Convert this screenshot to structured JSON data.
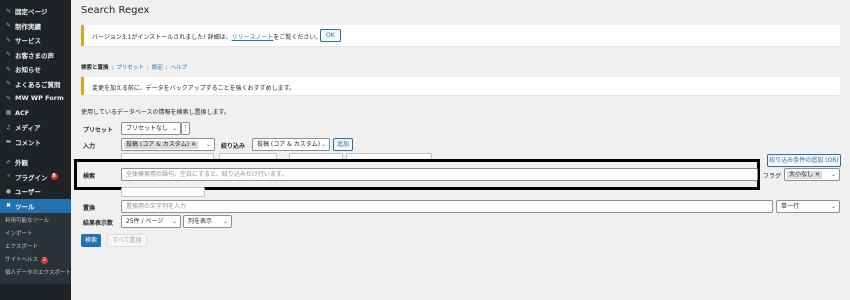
{
  "sidebar": {
    "items": [
      {
        "icon": "pin-icon",
        "glyph": "✎",
        "label": "固定ページ"
      },
      {
        "icon": "pin-icon",
        "glyph": "✎",
        "label": "制作実績"
      },
      {
        "icon": "pin-icon",
        "glyph": "✎",
        "label": "サービス"
      },
      {
        "icon": "pin-icon",
        "glyph": "✎",
        "label": "お客さまの声"
      },
      {
        "icon": "pin-icon",
        "glyph": "✎",
        "label": "お知らせ"
      },
      {
        "icon": "pin-icon",
        "glyph": "✎",
        "label": "よくあるご質問"
      },
      {
        "icon": "pin-icon",
        "glyph": "✎",
        "label": "MW WP Form"
      },
      {
        "icon": "grid-icon",
        "glyph": "▦",
        "label": "ACF"
      },
      {
        "icon": "media-icon",
        "glyph": "♫",
        "label": "メディア"
      },
      {
        "icon": "comment-icon",
        "glyph": "▬",
        "label": "コメント"
      }
    ],
    "items2": [
      {
        "icon": "appearance-icon",
        "glyph": "✐",
        "label": "外観"
      },
      {
        "icon": "plugin-icon",
        "glyph": "⚡",
        "label": "プラグイン",
        "badge": "8"
      },
      {
        "icon": "user-icon",
        "glyph": "●",
        "label": "ユーザー"
      },
      {
        "icon": "wrench-icon",
        "glyph": "✖",
        "label": "ツール"
      }
    ],
    "submenu": [
      {
        "label": "利用可能なツール"
      },
      {
        "label": "インポート"
      },
      {
        "label": "エクスポート"
      },
      {
        "label": "サイトヘルス",
        "badge": "2"
      },
      {
        "label": "個人データのエクスポート"
      }
    ]
  },
  "page": {
    "title": "Search Regex",
    "notice1": {
      "text": "バージョン3.1がインストールされました! 詳細は、",
      "link": "リリースノート",
      "after": "をご覧ください。",
      "ok": "OK"
    },
    "tabs": [
      "検索と置換",
      "プリセット",
      "設定",
      "ヘルプ"
    ],
    "notice2": "変更を加える前に、データをバックアップすることを強くおすすめします。",
    "desc": "使用しているデータベースの情報を検索し置換します。"
  },
  "form": {
    "preset_label": "プリセット",
    "preset_value": "プリセットなし",
    "input_label": "入力",
    "input_tag": "投稿 (コア & カスタム)",
    "filter_label": "絞り込み",
    "filter_value": "投稿 (コア & カスタム)",
    "add_button": "追加",
    "add_filter_button": "絞り込み条件の追加 (OR)",
    "search_label": "検索",
    "search_placeholder": "全体検索用の語句。空白にすると、絞り込みだけ行います。",
    "flag_label": "フラグ",
    "flag_tag": "大小なし",
    "replace_label": "置換",
    "replace_placeholder": "置換用の文字列を入力",
    "replace_mode": "単一行",
    "results_label": "結果表示数",
    "results_value": "25件 / ページ",
    "columns_value": "列を表示",
    "search_button": "検索",
    "replace_all_button": "すべて置換"
  }
}
